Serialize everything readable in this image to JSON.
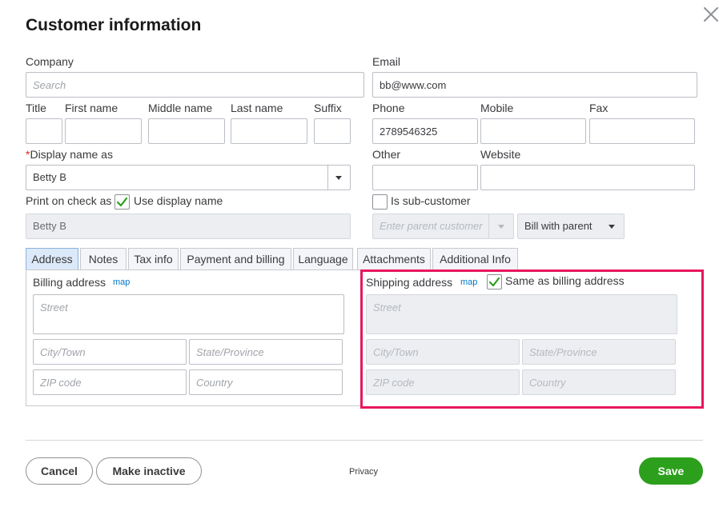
{
  "dialog": {
    "title": "Customer information"
  },
  "company": {
    "label": "Company",
    "placeholder": "Search"
  },
  "email": {
    "label": "Email",
    "value": "bb@www.com"
  },
  "name": {
    "title_label": "Title",
    "first_label": "First name",
    "middle_label": "Middle name",
    "last_label": "Last name",
    "suffix_label": "Suffix"
  },
  "phone": {
    "label": "Phone",
    "value": "2789546325"
  },
  "mobile": {
    "label": "Mobile"
  },
  "fax": {
    "label": "Fax"
  },
  "display_name": {
    "required_mark": "*",
    "label": "Display name as",
    "value": "Betty B"
  },
  "other": {
    "label": "Other"
  },
  "website": {
    "label": "Website"
  },
  "print_check": {
    "label": "Print on check as",
    "use_display_label": "Use display name",
    "use_display_checked": true,
    "value": "Betty B"
  },
  "sub_customer": {
    "label": "Is sub-customer",
    "checked": false,
    "parent_placeholder": "Enter parent customer",
    "billing_option": "Bill with parent"
  },
  "tabs": [
    {
      "label": "Address",
      "active": true
    },
    {
      "label": "Notes",
      "active": false
    },
    {
      "label": "Tax info",
      "active": false
    },
    {
      "label": "Payment and billing",
      "active": false
    },
    {
      "label": "Language",
      "active": false
    },
    {
      "label": "Attachments",
      "active": false
    },
    {
      "label": "Additional Info",
      "active": false
    }
  ],
  "billing": {
    "title": "Billing address",
    "map_label": "map",
    "street_placeholder": "Street",
    "city_placeholder": "City/Town",
    "state_placeholder": "State/Province",
    "zip_placeholder": "ZIP code",
    "country_placeholder": "Country"
  },
  "shipping": {
    "title": "Shipping address",
    "map_label": "map",
    "same_label": "Same as billing address",
    "same_checked": true,
    "street_placeholder": "Street",
    "city_placeholder": "City/Town",
    "state_placeholder": "State/Province",
    "zip_placeholder": "ZIP code",
    "country_placeholder": "Country",
    "highlight_color": "#e8175d"
  },
  "footer": {
    "cancel_label": "Cancel",
    "inactive_label": "Make inactive",
    "privacy_label": "Privacy",
    "save_label": "Save"
  },
  "colors": {
    "primary_green": "#2ca01c",
    "link_blue": "#0077c5",
    "check_green": "#2ca01c"
  }
}
